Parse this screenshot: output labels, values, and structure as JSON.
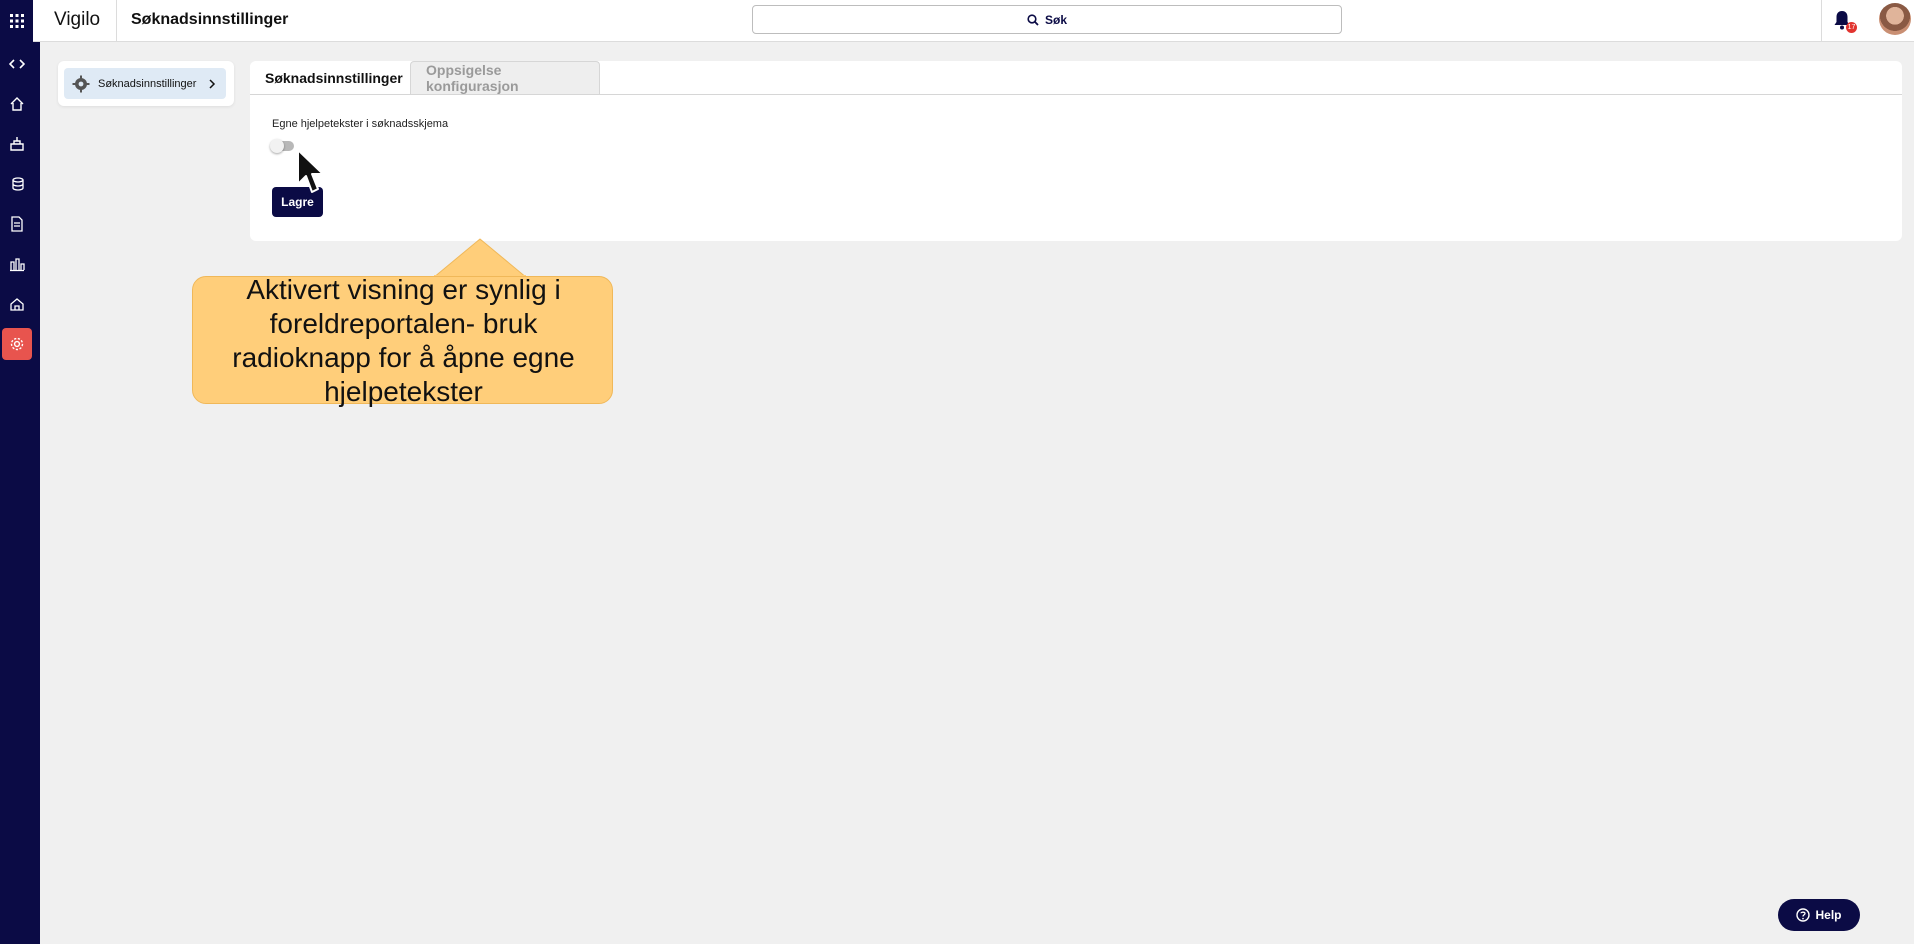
{
  "app": {
    "name": "Vigilo"
  },
  "header": {
    "title": "Søknadsinnstillinger",
    "search_label": "Søk",
    "notification_count": "17"
  },
  "rail": {
    "icons": [
      "code-toggle-icon",
      "home-icon",
      "school-icon",
      "coins-icon",
      "document-icon",
      "chart-icon",
      "kindergarten-icon",
      "settings-icon"
    ],
    "active": "settings-icon",
    "accent": "#e8544e",
    "background": "#0b0b45"
  },
  "submenu": {
    "items": [
      {
        "label": "Søknadsinnstillinger"
      }
    ]
  },
  "tabs": [
    {
      "label": "Søknadsinnstillinger",
      "active": true
    },
    {
      "label": "Oppsigelse konfigurasjon",
      "active": false
    }
  ],
  "form": {
    "toggle_label": "Egne hjelpetekster i søknadsskjema",
    "toggle_on": false,
    "save_label": "Lagre"
  },
  "callout": {
    "text": "Aktivert visning er synlig i foreldreportalen- bruk radioknapp for å åpne egne hjelpetekster",
    "color": "#ffce7a"
  },
  "help": {
    "label": "Help"
  }
}
